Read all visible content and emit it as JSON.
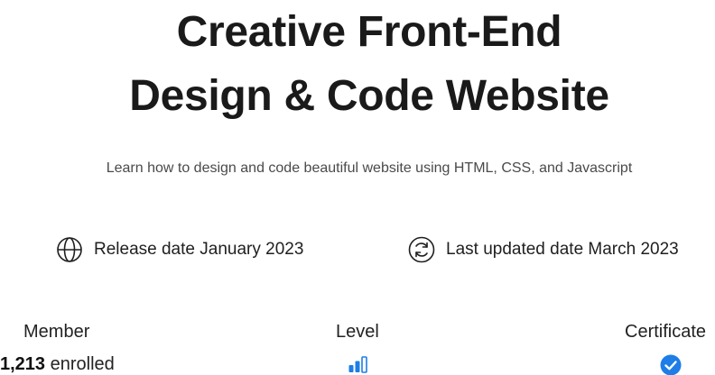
{
  "hero": {
    "title_line1": "Creative Front-End",
    "title_line2": "Design & Code Website",
    "subtitle": "Learn how to design and code beautiful website using HTML, CSS, and Javascript"
  },
  "meta": {
    "release": {
      "icon": "globe-icon",
      "text": "Release date January 2023"
    },
    "updated": {
      "icon": "refresh-icon",
      "text": "Last updated date March 2023"
    }
  },
  "stats": {
    "member": {
      "label": "Member",
      "count": "1,213",
      "suffix": "enrolled"
    },
    "level": {
      "label": "Level",
      "icon": "level-bars-icon",
      "accent": "#1e7de6"
    },
    "certificate": {
      "label": "Certificate",
      "icon": "check-circle-icon",
      "accent": "#1e7de6"
    }
  }
}
